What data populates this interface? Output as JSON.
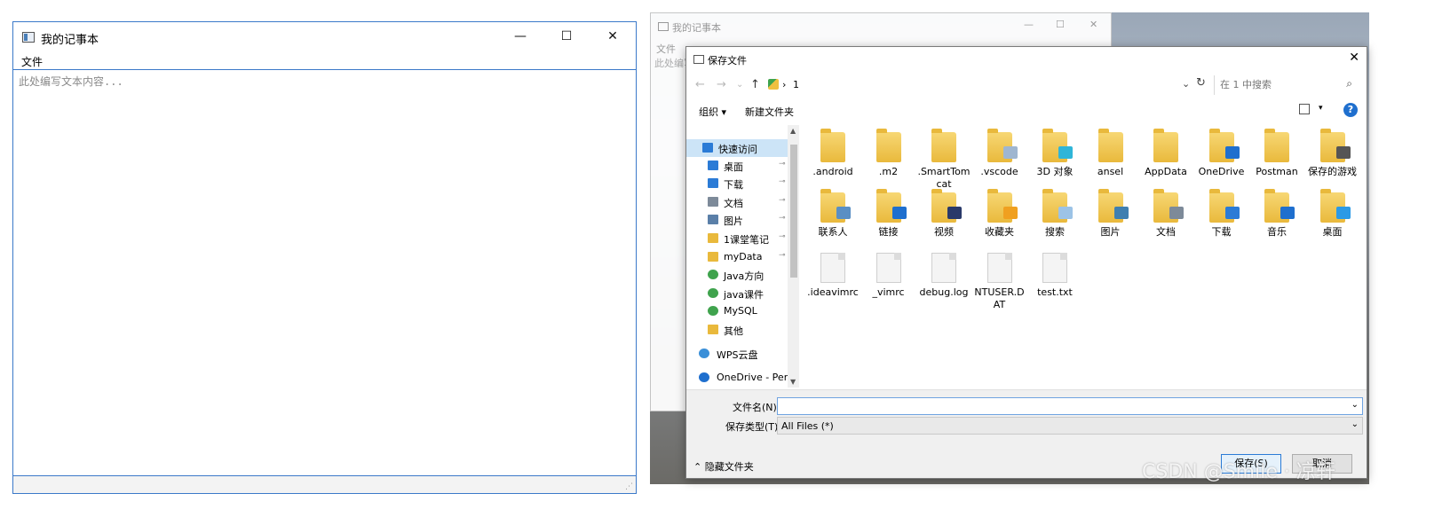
{
  "notepad": {
    "title": "我的记事本",
    "menu_file": "文件",
    "editor_placeholder": "此处编写文本内容...",
    "minimize_glyph": "—",
    "maximize_glyph": "☐",
    "close_glyph": "✕"
  },
  "notepad_background": {
    "title": "我的记事本",
    "menu_file": "文件",
    "editor_text": "此处编写"
  },
  "dialog": {
    "title": "保存文件",
    "close_glyph": "✕",
    "nav": {
      "back": "←",
      "forward": "→",
      "dropdown": "⌄",
      "up": "↑",
      "breadcrumb": "1",
      "breadcrumb_sep": "›",
      "history_dd": "⌄",
      "refresh": "↻",
      "search_placeholder": "在 1 中搜索",
      "search_icon": "⌕"
    },
    "toolbar": {
      "organize": "组织 ▾",
      "new_folder": "新建文件夹",
      "view_dd": "▾",
      "help": "?"
    },
    "nav_pane": [
      {
        "label": "快速访问",
        "icon": "star-icon",
        "pinned": false,
        "selected": true
      },
      {
        "label": "桌面",
        "icon": "desktop-icon",
        "pinned": true
      },
      {
        "label": "下载",
        "icon": "download-icon",
        "pinned": true
      },
      {
        "label": "文档",
        "icon": "document-icon",
        "pinned": true
      },
      {
        "label": "图片",
        "icon": "pictures-icon",
        "pinned": true
      },
      {
        "label": "1课堂笔记",
        "icon": "folder-icon",
        "pinned": true
      },
      {
        "label": "myData",
        "icon": "folder-icon",
        "pinned": true
      },
      {
        "label": "Java方向",
        "icon": "green-folder-icon",
        "pinned": false
      },
      {
        "label": "java课件",
        "icon": "green-folder-icon",
        "pinned": false
      },
      {
        "label": "MySQL",
        "icon": "green-folder-icon",
        "pinned": false
      },
      {
        "label": "其他",
        "icon": "folder-icon",
        "pinned": false
      },
      {
        "label": "WPS云盘",
        "icon": "cloud-icon",
        "pinned": false
      },
      {
        "label": "OneDrive - Perso",
        "icon": "onedrive-icon",
        "pinned": false
      }
    ],
    "pin_glyph": "📌",
    "files_row1": [
      {
        "name": ".android",
        "kind": "folder"
      },
      {
        "name": ".m2",
        "kind": "folder"
      },
      {
        "name": ".SmartTomcat",
        "kind": "folder"
      },
      {
        "name": ".vscode",
        "kind": "folder"
      },
      {
        "name": "3D 对象",
        "kind": "folder"
      },
      {
        "name": "ansel",
        "kind": "folder"
      },
      {
        "name": "AppData",
        "kind": "folder"
      },
      {
        "name": "OneDrive",
        "kind": "folder"
      },
      {
        "name": "Postman",
        "kind": "folder"
      },
      {
        "name": "保存的游戏",
        "kind": "folder"
      }
    ],
    "files_row2": [
      {
        "name": "联系人",
        "kind": "folder"
      },
      {
        "name": "链接",
        "kind": "folder"
      },
      {
        "name": "视频",
        "kind": "folder"
      },
      {
        "name": "收藏夹",
        "kind": "folder"
      },
      {
        "name": "搜索",
        "kind": "folder"
      },
      {
        "name": "图片",
        "kind": "folder"
      },
      {
        "name": "文档",
        "kind": "folder"
      },
      {
        "name": "下载",
        "kind": "folder"
      },
      {
        "name": "音乐",
        "kind": "folder"
      },
      {
        "name": "桌面",
        "kind": "folder"
      }
    ],
    "files_row3": [
      {
        "name": ".ideavimrc",
        "kind": "file"
      },
      {
        "name": "_vimrc",
        "kind": "file"
      },
      {
        "name": "debug.log",
        "kind": "file"
      },
      {
        "name": "NTUSER.DAT",
        "kind": "file"
      },
      {
        "name": "test.txt",
        "kind": "file"
      }
    ],
    "filename_label": "文件名(N):",
    "filename_value": "",
    "filetype_label": "保存类型(T):",
    "filetype_value": "All Files (*)",
    "dropdown_glyph": "⌄",
    "hide_folders": "⌃ 隐藏文件夹",
    "save_button": "保存(S)",
    "cancel_button": "取消"
  },
  "watermark": "CSDN @Smile · 凉轩",
  "colors": {
    "accent": "#3b79c9",
    "folder": "#e9b93c",
    "selection": "#cce4f7",
    "help": "#1f6fce"
  }
}
